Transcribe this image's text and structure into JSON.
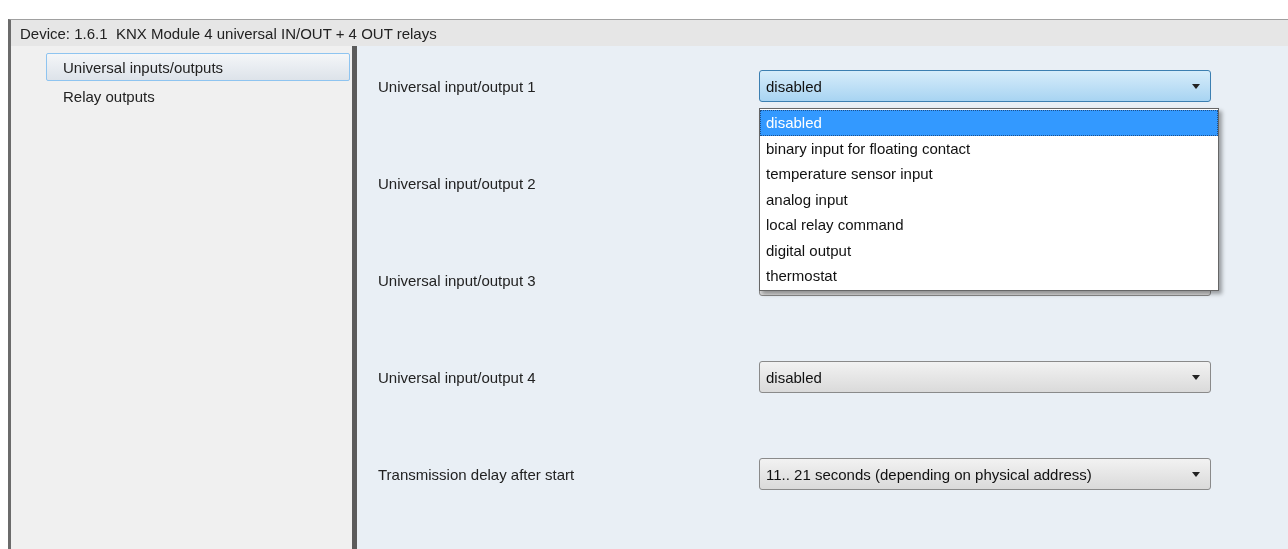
{
  "window": {
    "title": "Device: 1.6.1  KNX Module 4 universal IN/OUT + 4 OUT relays"
  },
  "sidebar": {
    "items": [
      {
        "label": "Universal inputs/outputs",
        "selected": true
      },
      {
        "label": "Relay outputs",
        "selected": false
      }
    ]
  },
  "parameters": [
    {
      "label": "Universal input/output 1",
      "value": "disabled",
      "open": true
    },
    {
      "label": "Universal input/output 2",
      "field_hidden": true
    },
    {
      "label": "Universal input/output 3",
      "open": false
    },
    {
      "label": "Universal input/output 4",
      "value": "disabled",
      "open": false
    },
    {
      "label": "Transmission delay after start",
      "value": "11.. 21 seconds (depending on physical address)",
      "open": false
    }
  ],
  "dropdown_list": {
    "options": [
      {
        "label": "disabled",
        "selected": true
      },
      {
        "label": "binary input for floating contact",
        "selected": false
      },
      {
        "label": "temperature sensor input",
        "selected": false
      },
      {
        "label": "analog input",
        "selected": false
      },
      {
        "label": "local relay command",
        "selected": false
      },
      {
        "label": "digital output",
        "selected": false
      },
      {
        "label": "thermostat",
        "selected": false
      }
    ]
  }
}
